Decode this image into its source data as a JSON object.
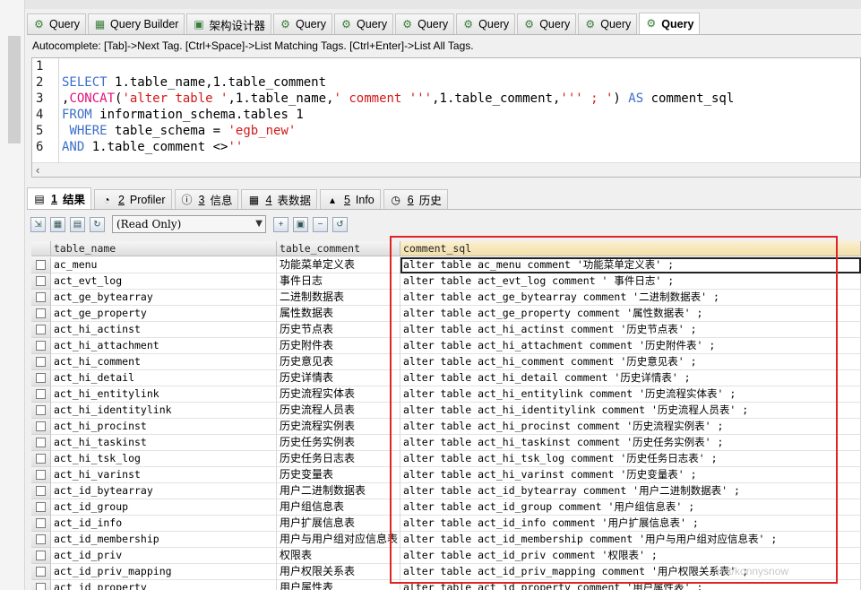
{
  "tabs": [
    {
      "label": "Query",
      "icon": "query-icon",
      "active": false
    },
    {
      "label": "Query Builder",
      "icon": "query-builder-icon",
      "active": false
    },
    {
      "label": "架构设计器",
      "icon": "schema-designer-icon",
      "active": false
    },
    {
      "label": "Query",
      "icon": "query-icon",
      "active": false
    },
    {
      "label": "Query",
      "icon": "query-icon",
      "active": false
    },
    {
      "label": "Query",
      "icon": "query-icon",
      "active": false
    },
    {
      "label": "Query",
      "icon": "query-icon",
      "active": false
    },
    {
      "label": "Query",
      "icon": "query-icon",
      "active": false
    },
    {
      "label": "Query",
      "icon": "query-icon",
      "active": false
    },
    {
      "label": "Query",
      "icon": "query-icon",
      "active": true
    }
  ],
  "autocomplete_hint": "Autocomplete: [Tab]->Next Tag. [Ctrl+Space]->List Matching Tags. [Ctrl+Enter]->List All Tags.",
  "editor": {
    "line_numbers": [
      "1",
      "2",
      "3",
      "4",
      "5",
      "6"
    ],
    "lines": [
      "",
      "SELECT t1.table_name,t1.table_comment",
      ",CONCAT('alter table ',t1.table_name,' comment ''',t1.table_comment,''' ; ') AS comment_sql",
      "FROM information_schema.tables t1",
      " WHERE table_schema = 'egb_new'",
      "AND t1.table_comment <>''"
    ]
  },
  "result_tabs": [
    {
      "num": "1",
      "label": "结果",
      "icon": "grid-result-icon",
      "active": true
    },
    {
      "num": "2",
      "label": "Profiler",
      "icon": "profiler-icon",
      "active": false
    },
    {
      "num": "3",
      "label": "信息",
      "icon": "info-icon",
      "active": false
    },
    {
      "num": "4",
      "label": "表数据",
      "icon": "table-data-icon",
      "active": false
    },
    {
      "num": "5",
      "label": "Info",
      "icon": "info-chart-icon",
      "active": false
    },
    {
      "num": "6",
      "label": "历史",
      "icon": "history-icon",
      "active": false
    }
  ],
  "result_toolbar": {
    "mode": "(Read Only)"
  },
  "grid": {
    "columns": [
      "table_name",
      "table_comment",
      "comment_sql"
    ],
    "rows": [
      [
        "ac_menu",
        "功能菜单定义表",
        "alter table ac_menu comment '功能菜单定义表' ;"
      ],
      [
        "act_evt_log",
        " 事件日志",
        "alter table act_evt_log comment ' 事件日志' ;"
      ],
      [
        "act_ge_bytearray",
        "二进制数据表",
        "alter table act_ge_bytearray comment '二进制数据表' ;"
      ],
      [
        "act_ge_property",
        "属性数据表",
        "alter table act_ge_property comment '属性数据表' ;"
      ],
      [
        "act_hi_actinst",
        "历史节点表",
        "alter table act_hi_actinst comment '历史节点表' ;"
      ],
      [
        "act_hi_attachment",
        "历史附件表",
        "alter table act_hi_attachment comment '历史附件表' ;"
      ],
      [
        "act_hi_comment",
        "历史意见表",
        "alter table act_hi_comment comment '历史意见表' ;"
      ],
      [
        "act_hi_detail",
        "历史详情表",
        "alter table act_hi_detail comment '历史详情表' ;"
      ],
      [
        "act_hi_entitylink",
        "历史流程实体表",
        "alter table act_hi_entitylink comment '历史流程实体表' ;"
      ],
      [
        "act_hi_identitylink",
        "历史流程人员表",
        "alter table act_hi_identitylink comment '历史流程人员表' ;"
      ],
      [
        "act_hi_procinst",
        "历史流程实例表",
        "alter table act_hi_procinst comment '历史流程实例表' ;"
      ],
      [
        "act_hi_taskinst",
        "历史任务实例表",
        "alter table act_hi_taskinst comment '历史任务实例表' ;"
      ],
      [
        "act_hi_tsk_log",
        "历史任务日志表",
        "alter table act_hi_tsk_log comment '历史任务日志表' ;"
      ],
      [
        "act_hi_varinst",
        "历史变量表",
        "alter table act_hi_varinst comment '历史变量表' ;"
      ],
      [
        "act_id_bytearray",
        "用户二进制数据表",
        "alter table act_id_bytearray comment '用户二进制数据表' ;"
      ],
      [
        "act_id_group",
        "用户组信息表",
        "alter table act_id_group comment '用户组信息表' ;"
      ],
      [
        "act_id_info",
        "用户扩展信息表",
        "alter table act_id_info comment '用户扩展信息表' ;"
      ],
      [
        "act_id_membership",
        "用户与用户组对应信息表",
        "alter table act_id_membership comment '用户与用户组对应信息表' ;"
      ],
      [
        "act_id_priv",
        "权限表",
        "alter table act_id_priv comment '权限表' ;"
      ],
      [
        "act_id_priv_mapping",
        "用户权限关系表",
        "alter table act_id_priv_mapping comment '用户权限关系表' ;"
      ],
      [
        "act_id_property",
        "用户属性表",
        "alter table act_id_property comment '用户属性表' ;"
      ]
    ]
  },
  "watermark": "net/konnysnow",
  "colors": {
    "highlight": "#e02424",
    "keyword": "#3b6fc9",
    "function": "#e0117a",
    "string": "#d21818"
  }
}
